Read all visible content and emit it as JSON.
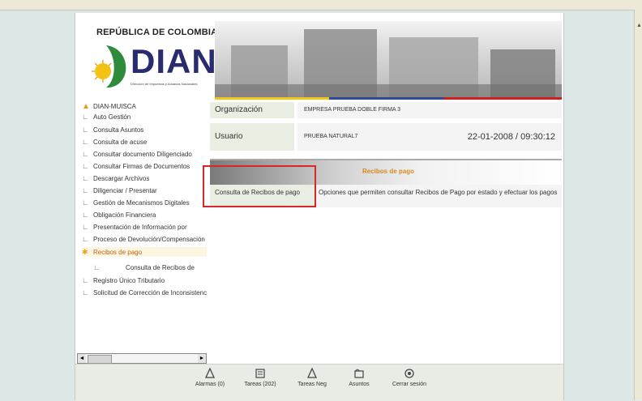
{
  "header": {
    "country": "REPÚBLICA DE COLOMBIA",
    "brand": "DIAN",
    "brand_sub": "Dirección de Impuestos y Aduanas Nacionales"
  },
  "sidebar": {
    "root": "DIAN-MUISCA",
    "items": [
      {
        "label": "Auto Gestión"
      },
      {
        "label": "Consulta Asuntos"
      },
      {
        "label": "Consulta de acuse"
      },
      {
        "label": "Consultar documento Diligenciado"
      },
      {
        "label": "Consultar Firmas de Documentos"
      },
      {
        "label": "Descargar Archivos"
      },
      {
        "label": "Diligenciar / Presentar"
      },
      {
        "label": "Gestión de Mecanismos Digitales"
      },
      {
        "label": "Obligación Financiera"
      },
      {
        "label": "Presentación de Información por"
      },
      {
        "label": "Proceso de Devolución/Compensación"
      },
      {
        "label": "Recibos de pago"
      },
      {
        "label": "Consulta de Recibos de"
      },
      {
        "label": "Registro Único Tributario"
      },
      {
        "label": "Solicitud de Corrección de Inconsistencias"
      }
    ],
    "selected": "Recibos de pago"
  },
  "info": {
    "org_label": "Organización",
    "org_value": "EMPRESA PRUEBA DOBLE FIRMA 3",
    "user_label": "Usuario",
    "user_value": "PRUEBA NATURAL7",
    "datetime": "22-01-2008 / 09:30:12"
  },
  "section": {
    "title": "Recibos de pago",
    "link": "Consulta de Recibos de pago",
    "description": "Opciones que permiten consultar Recibos de Pago por estado y efectuar los pagos"
  },
  "footer": {
    "items": [
      {
        "label": "Alarmas (0)",
        "icon": "bell-icon"
      },
      {
        "label": "Tareas (202)",
        "icon": "tasks-icon"
      },
      {
        "label": "Tareas Neg",
        "icon": "bell-icon"
      },
      {
        "label": "Asuntos",
        "icon": "folder-icon"
      },
      {
        "label": "Cerrar sesión",
        "icon": "power-icon"
      }
    ]
  },
  "colors": {
    "accent": "#d98a1f",
    "highlight_box": "#d9262a",
    "label_bg": "#e8eee2",
    "brand_blue": "#2a2a6e"
  }
}
